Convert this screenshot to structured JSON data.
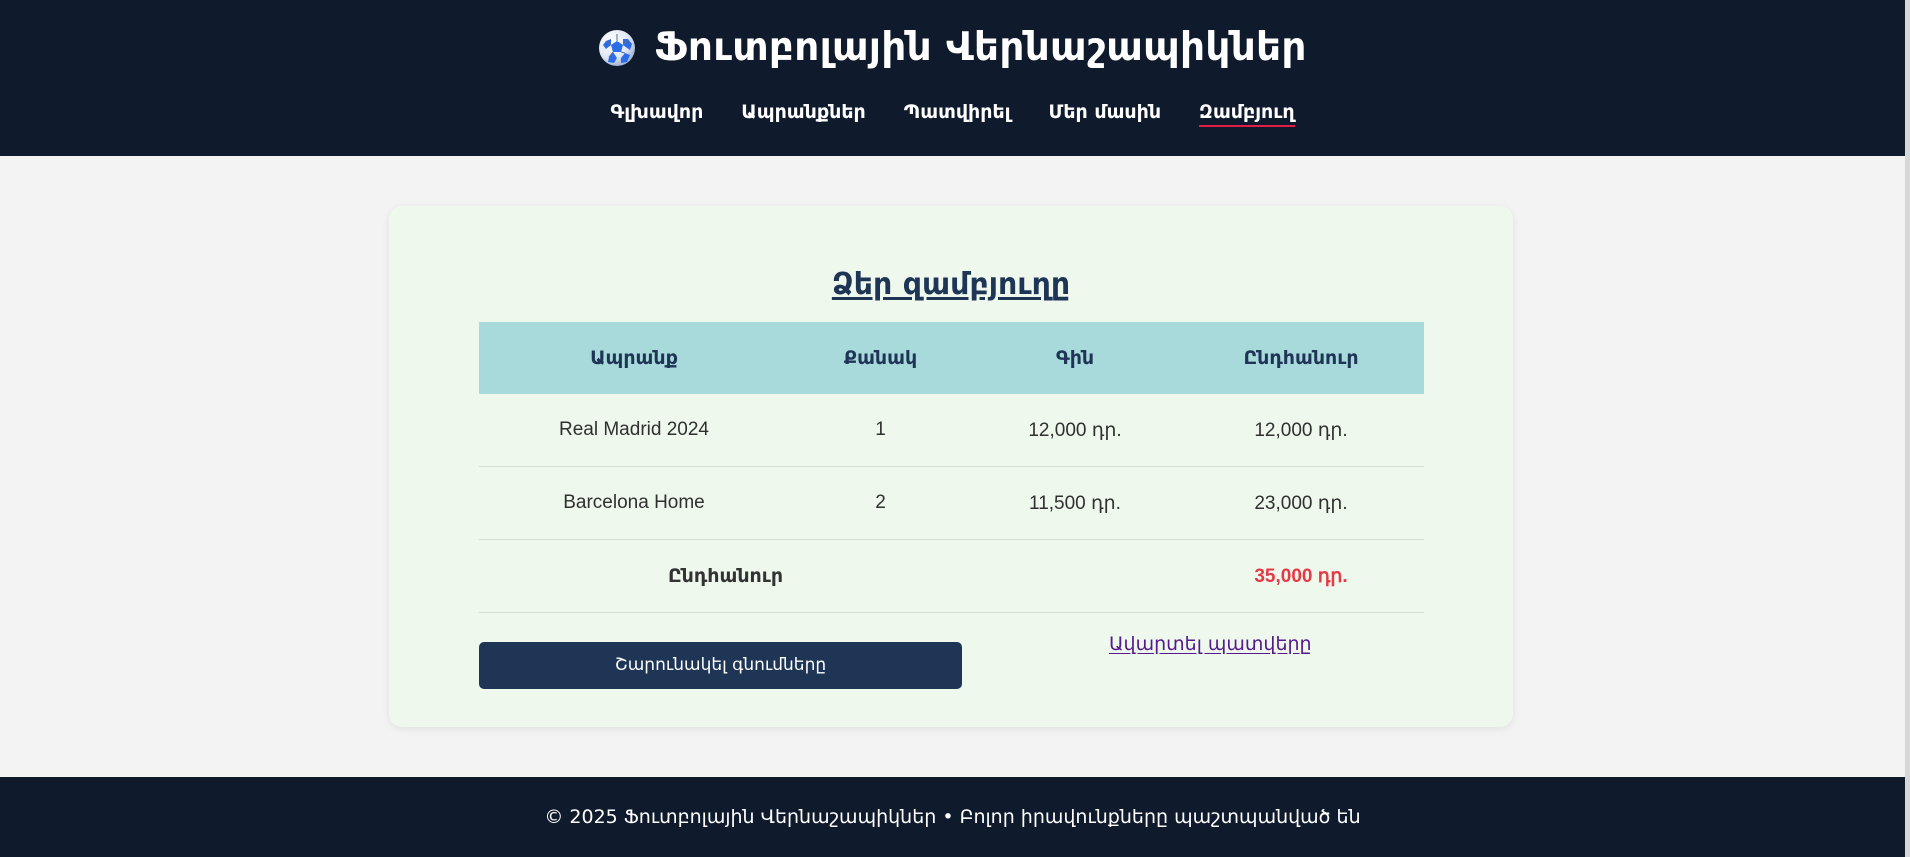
{
  "header": {
    "title": "Ֆուտբոլային Վերնաշապիկներ",
    "logo_icon": "soccer-ball-icon",
    "nav": [
      {
        "label": "Գլխավոր"
      },
      {
        "label": "Ապրանքներ"
      },
      {
        "label": "Պատվիրել"
      },
      {
        "label": "Մեր մասին"
      },
      {
        "label": "Զամբյուղ",
        "active": true
      }
    ]
  },
  "cart": {
    "title": "Ձեր զամբյուղը",
    "columns": [
      "Ապրանք",
      "Քանակ",
      "Գին",
      "Ընդհանուր"
    ],
    "rows": [
      {
        "product": "Real Madrid 2024",
        "quantity": "1",
        "price": "12,000 դր.",
        "total": "12,000 դր."
      },
      {
        "product": "Barcelona Home",
        "quantity": "2",
        "price": "11,500 դր.",
        "total": "23,000 դր."
      }
    ],
    "summary": {
      "label": "Ընդհանուր",
      "value": "35,000 դր."
    },
    "continue_button": "Շարունակել գնումները",
    "checkout_link": "Ավարտել պատվերը"
  },
  "footer": {
    "text": "© 2025 Ֆուտբոլային Վերնաշապիկներ • Բոլոր իրավունքները պաշտպանված են"
  },
  "colors": {
    "header_bg": "#0f1b2d",
    "accent": "#e63946",
    "primary": "#1f3556",
    "table_header": "#a8dadc",
    "card_bg": "#eef8ed"
  }
}
